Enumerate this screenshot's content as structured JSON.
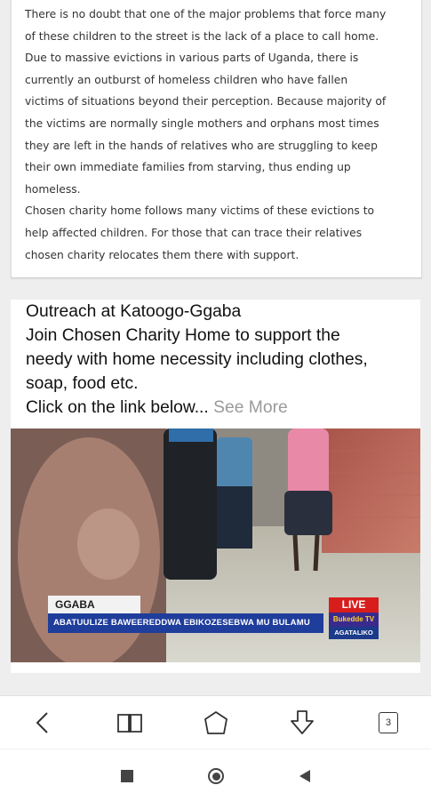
{
  "article": {
    "text": "There is no doubt that one of the major problems that force many\nof these children to the street is the lack of a place to call home.\nDue to massive evictions in various parts of Uganda, there is\ncurrently an outburst of homeless children who have fallen\nvictims of situations beyond their perception. Because majority of\nthe victims are normally single mothers and orphans most times\nthey are left in the hands of relatives who are struggling to keep\ntheir own immediate families from starving, thus ending up\nhomeless.\nChosen charity home follows many victims of these evictions to\nhelp affected children. For those that can trace their relatives\nchosen charity relocates them there with support."
  },
  "post": {
    "text": "Outreach at Katoogo-Ggaba\nJoin Chosen Charity Home to support the\nneedy with home necessity including clothes,\nsoap, food etc.\nClick on the link below... ",
    "see_more": "See More"
  },
  "video": {
    "location_tag": "GGABA",
    "headline": "ABATUULIZE BAWEEREDDWA EBIKOZESEBWA MU BULAMU",
    "live_label": "LIVE",
    "channel_label": "Bukedde TV",
    "channel_sub": "AGATALIKO"
  },
  "toolbar": {
    "tab_count": "3",
    "icons": [
      "back-icon",
      "bookmarks-icon",
      "home-icon",
      "download-icon",
      "tabs-icon"
    ]
  },
  "navbar": {
    "icons": [
      "recents-square-icon",
      "home-circle-icon",
      "back-triangle-icon"
    ]
  },
  "colors": {
    "headline_bar": "#1f3d9b",
    "live_badge": "#d81d1d",
    "see_more": "#9a9a9a"
  }
}
